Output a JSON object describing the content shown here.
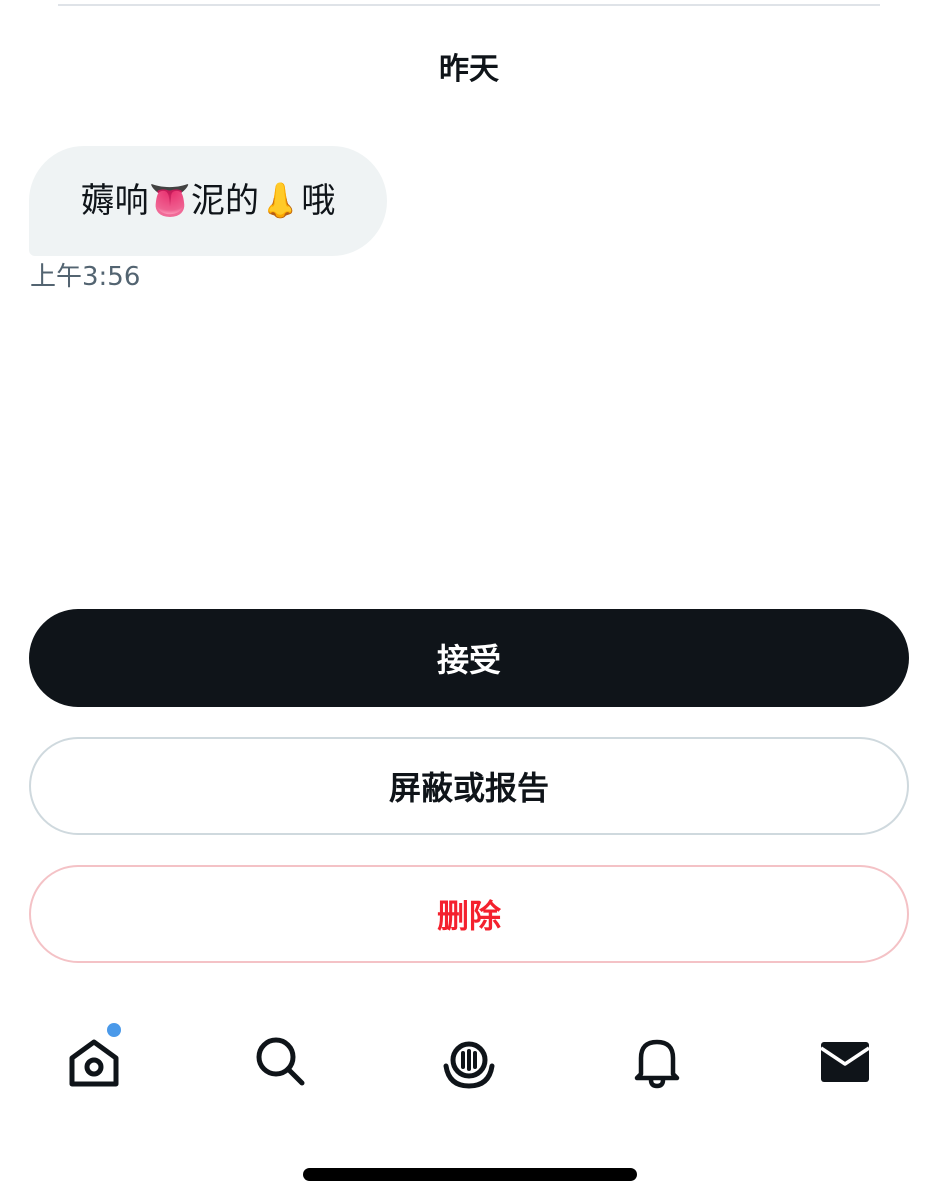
{
  "conversation": {
    "date_label": "昨天",
    "messages": [
      {
        "text": "薅响👅泥的👃哦",
        "time": "上午3:56"
      }
    ]
  },
  "actions": {
    "accept_label": "接受",
    "block_report_label": "屏蔽或报告",
    "delete_label": "删除"
  },
  "tabbar": {
    "items": [
      {
        "icon": "home-icon",
        "has_notification_dot": true
      },
      {
        "icon": "search-icon"
      },
      {
        "icon": "spaces-icon"
      },
      {
        "icon": "bell-icon"
      },
      {
        "icon": "mail-icon",
        "active": true
      }
    ]
  },
  "colors": {
    "primary_text": "#0f1419",
    "secondary_text": "#536471",
    "bubble_bg": "#eff3f4",
    "danger": "#f4212e",
    "notification_dot": "#4a99e9"
  }
}
